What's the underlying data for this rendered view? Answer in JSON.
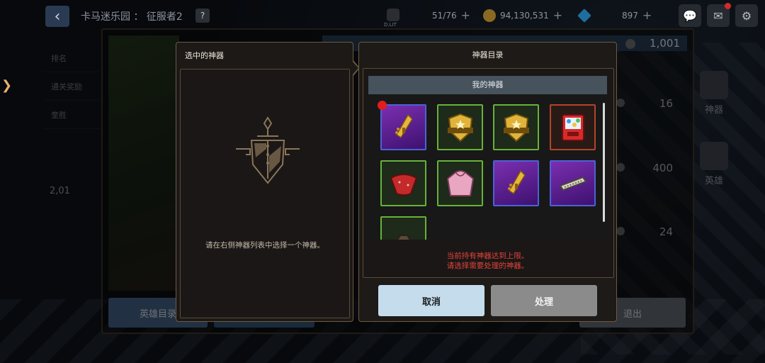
{
  "topbar": {
    "back_icon": "arrow-left-icon",
    "title": "卡马迷乐园 ： 征服者2",
    "help_label": "?",
    "coffee_caption": "D.LIT",
    "stamina": "51/76",
    "gold": "94,130,531",
    "gems": "897",
    "plus": "+"
  },
  "under": {
    "side_labels": [
      "排名",
      "通关奖励",
      "奎胜"
    ],
    "stat_values": [
      "2,01",
      ""
    ],
    "strip_value": "1,001",
    "right_values": [
      "16",
      "400",
      "24"
    ],
    "side_tags": [
      "神器",
      "英雄"
    ],
    "buttons": {
      "heroes": "英雄目录",
      "second": "",
      "exit": "退出"
    }
  },
  "selected_panel": {
    "title": "选中的神器",
    "hint": "请在右侧神器列表中选择一个神器。"
  },
  "catalog": {
    "title": "神器目录",
    "tab": "我的神器",
    "items": [
      {
        "name": "golden-chain-gun",
        "rarity": "purple",
        "new": true
      },
      {
        "name": "police-badge",
        "rarity": "green"
      },
      {
        "name": "police-badge",
        "rarity": "green"
      },
      {
        "name": "gacha-machine",
        "rarity": "red"
      },
      {
        "name": "red-bandana",
        "rarity": "green"
      },
      {
        "name": "pink-hoodie",
        "rarity": "green"
      },
      {
        "name": "golden-chain-gun",
        "rarity": "purple"
      },
      {
        "name": "harmonica",
        "rarity": "purple"
      },
      {
        "name": "dark-item",
        "rarity": "green"
      }
    ],
    "warning_line1": "当前持有神器达到上限。",
    "warning_line2": "请选择需要处理的神器。",
    "cancel_label": "取消",
    "process_label": "处理"
  },
  "colors": {
    "cancel_button": "#c4dcec",
    "process_button": "#8b8b8b",
    "warning_text": "#e2423a",
    "panel_border": "#6d5a42"
  }
}
